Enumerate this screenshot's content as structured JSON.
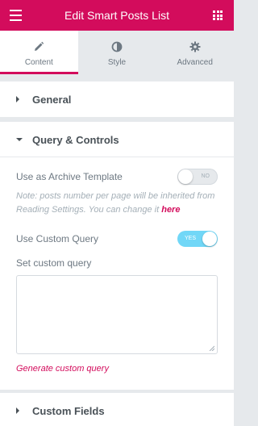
{
  "header": {
    "title": "Edit Smart Posts List",
    "menu_icon": "hamburger-icon",
    "apps_icon": "grid-icon"
  },
  "tabs": [
    {
      "label": "Content",
      "icon": "pencil-icon",
      "active": true
    },
    {
      "label": "Style",
      "icon": "contrast-icon",
      "active": false
    },
    {
      "label": "Advanced",
      "icon": "gear-icon",
      "active": false
    }
  ],
  "sections": {
    "general": {
      "label": "General"
    },
    "query": {
      "label": "Query & Controls",
      "archive_label": "Use as Archive Template",
      "archive_toggle": "NO",
      "note_text": "Note: posts number per page will be inherited from Reading Settings. You can change it ",
      "note_link": "here",
      "custom_query_label": "Use Custom Query",
      "custom_query_toggle": "YES",
      "set_query_label": "Set custom query",
      "set_query_value": "",
      "generate_link": "Generate custom query"
    },
    "custom_fields": {
      "label": "Custom Fields"
    }
  },
  "colors": {
    "accent": "#d30c5c",
    "toggle_on": "#71d7f7"
  }
}
